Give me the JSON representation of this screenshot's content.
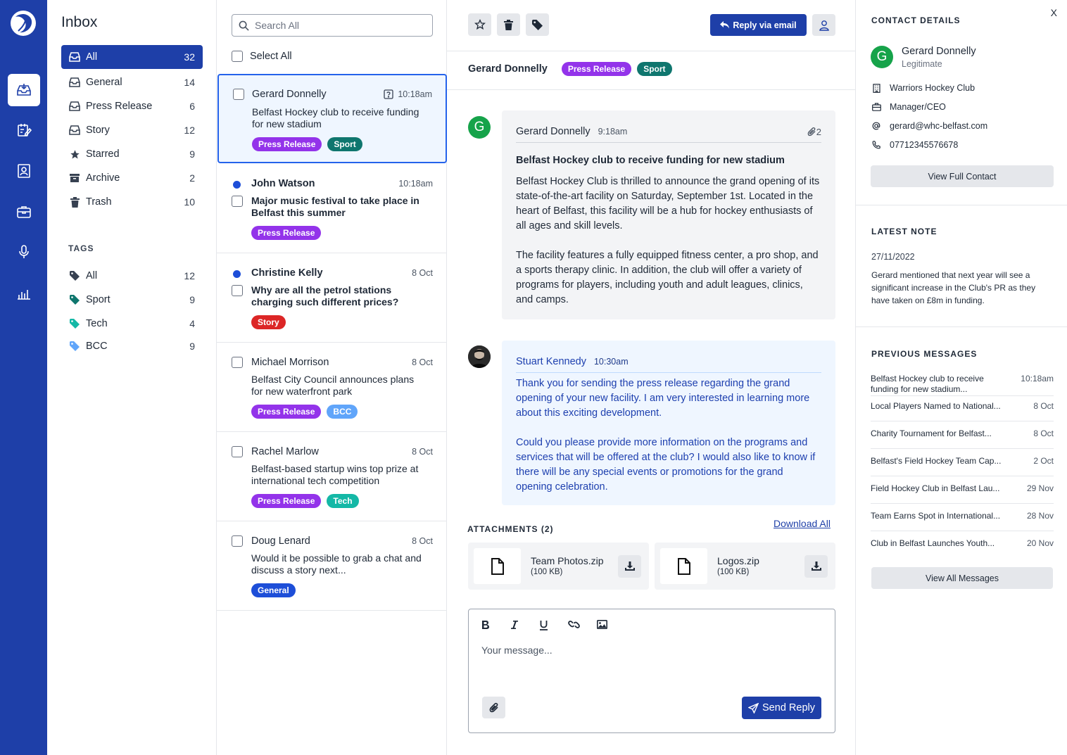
{
  "folders": {
    "title": "Inbox",
    "items": [
      {
        "label": "All",
        "count": "32"
      },
      {
        "label": "General",
        "count": "14"
      },
      {
        "label": "Press Release",
        "count": "6"
      },
      {
        "label": "Story",
        "count": "12"
      },
      {
        "label": "Starred",
        "count": "9"
      },
      {
        "label": "Archive",
        "count": "2"
      },
      {
        "label": "Trash",
        "count": "10"
      }
    ],
    "tags_heading": "TAGS",
    "tags": [
      {
        "label": "All",
        "count": "12",
        "color": "#374151"
      },
      {
        "label": "Sport",
        "count": "9",
        "color": "#0f766e"
      },
      {
        "label": "Tech",
        "count": "4",
        "color": "#14b8a6"
      },
      {
        "label": "BCC",
        "count": "9",
        "color": "#60a5fa"
      }
    ]
  },
  "list": {
    "search_placeholder": "Search All",
    "select_all": "Select All",
    "messages": [
      {
        "sender": "Gerard Donnelly",
        "time": "10:18am",
        "subject": "Belfast Hockey club to receive funding for new stadium",
        "tags": [
          "Press Release",
          "Sport"
        ]
      },
      {
        "sender": "John Watson",
        "time": "10:18am",
        "subject": "Major music festival to take place in Belfast this summer",
        "tags": [
          "Press Release"
        ]
      },
      {
        "sender": "Christine Kelly",
        "time": "8 Oct",
        "subject": "Why are all the petrol stations charging such different prices?",
        "tags": [
          "Story"
        ]
      },
      {
        "sender": "Michael Morrison",
        "time": "8 Oct",
        "subject": "Belfast City Council announces plans for new waterfront park",
        "tags": [
          "Press Release",
          "BCC"
        ]
      },
      {
        "sender": "Rachel Marlow",
        "time": "8 Oct",
        "subject": "Belfast-based startup wins top prize at international tech competition",
        "tags": [
          "Press Release",
          "Tech"
        ]
      },
      {
        "sender": "Doug Lenard",
        "time": "8 Oct",
        "subject": "Would it be possible to grab a chat and discuss a story next...",
        "tags": [
          "General"
        ]
      }
    ]
  },
  "toolbar": {
    "reply_label": "Reply via email"
  },
  "thread": {
    "name": "Gerard Donnelly",
    "tags": [
      "Press Release",
      "Sport"
    ],
    "message1": {
      "avatar": "G",
      "name": "Gerard Donnelly",
      "time": "9:18am",
      "attach_count": "2",
      "title": "Belfast Hockey club to receive funding for new stadium",
      "para1": "Belfast Hockey Club is thrilled to announce the grand opening of its state-of-the-art facility on Saturday, September 1st. Located in the heart of Belfast, this facility will be a hub for hockey enthusiasts of all ages and skill levels.",
      "para2": "The facility features a fully equipped fitness center, a pro shop, and a sports therapy clinic. In addition, the club will offer a variety of programs for players, including youth and adult leagues, clinics, and camps."
    },
    "message2": {
      "name": "Stuart Kennedy",
      "time": "10:30am",
      "para1": "Thank you for sending the press release regarding the grand opening of your new facility. I am very interested in learning more about this exciting development.",
      "para2": "Could you please provide more information on the programs and services that will be offered at the club? I would also like to know if there will be any special events or promotions for the grand opening celebration."
    }
  },
  "attachments": {
    "heading": "ATTACHMENTS (2)",
    "download_all": "Download All",
    "files": [
      {
        "name": "Team Photos.zip",
        "size": "(100 KB)"
      },
      {
        "name": "Logos.zip",
        "size": "(100 KB)"
      }
    ]
  },
  "composer": {
    "placeholder": "Your message...",
    "send_label": "Send Reply"
  },
  "contact": {
    "close": "X",
    "heading": "CONTACT DETAILS",
    "avatar": "G",
    "name": "Gerard Donnelly",
    "status": "Legitimate",
    "organisation": "Warriors Hockey Club",
    "role": "Manager/CEO",
    "email": "gerard@whc-belfast.com",
    "phone": "07712345576678",
    "view_full": "View Full Contact",
    "note_heading": "LATEST NOTE",
    "note_date": "27/11/2022",
    "note_body": "Gerard mentioned that next year will see a significant increase in the Club's PR as they have taken on £8m in funding.",
    "prev_heading": "PREVIOUS MESSAGES",
    "previous": [
      {
        "text": "Belfast Hockey club to receive funding for new stadium...",
        "date": "10:18am"
      },
      {
        "text": "Local Players Named to National...",
        "date": "8 Oct"
      },
      {
        "text": "Charity Tournament for Belfast...",
        "date": "8 Oct"
      },
      {
        "text": "Belfast's Field Hockey Team Cap...",
        "date": "2 Oct"
      },
      {
        "text": "Field Hockey Club in Belfast Lau...",
        "date": "29 Nov"
      },
      {
        "text": "Team Earns Spot in International...",
        "date": "28 Nov"
      },
      {
        "text": "Club in Belfast Launches Youth...",
        "date": "20 Nov"
      }
    ],
    "view_all": "View All Messages"
  }
}
